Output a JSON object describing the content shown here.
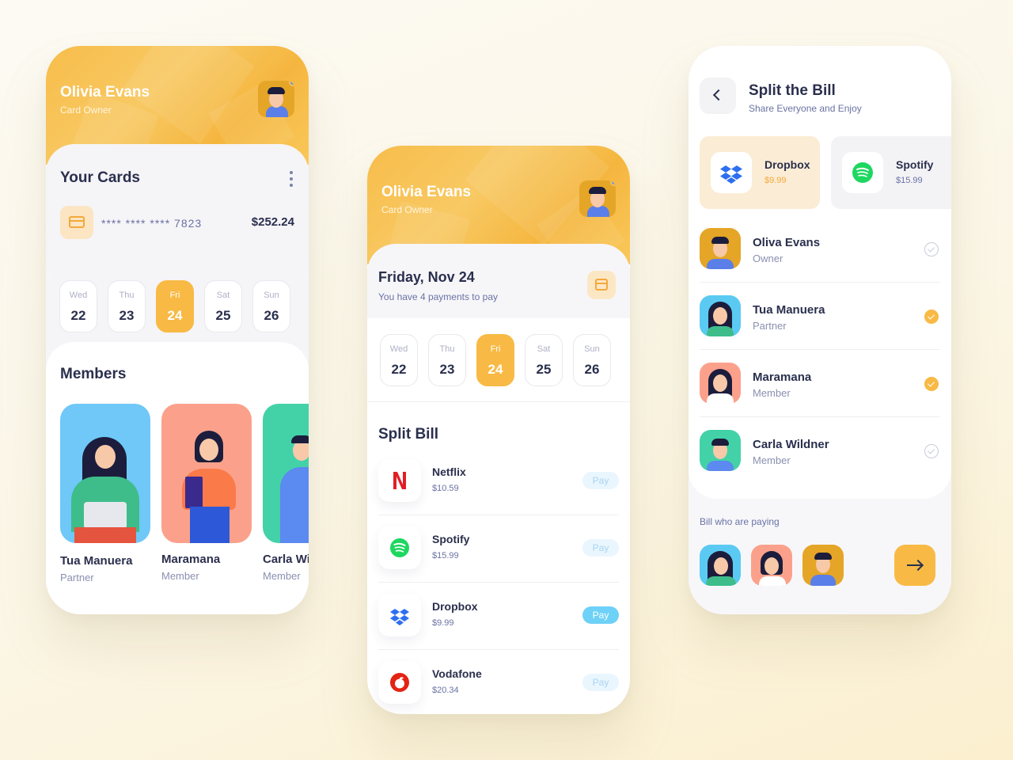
{
  "owner": {
    "name": "Olivia Evans",
    "role": "Card Owner"
  },
  "cards": {
    "title": "Your Cards",
    "number": "**** **** **** 7823",
    "amount": "$252.24"
  },
  "dates": [
    {
      "day": "Wed",
      "num": "22",
      "active": false
    },
    {
      "day": "Thu",
      "num": "23",
      "active": false
    },
    {
      "day": "Fri",
      "num": "24",
      "active": true
    },
    {
      "day": "Sat",
      "num": "25",
      "active": false
    },
    {
      "day": "Sun",
      "num": "26",
      "active": false
    }
  ],
  "members": {
    "title": "Members",
    "items": [
      {
        "name": "Tua Manuera",
        "role": "Partner"
      },
      {
        "name": "Maramana",
        "role": "Member"
      },
      {
        "name": "Carla Wildner",
        "role": "Member"
      }
    ]
  },
  "today": {
    "title": "Friday, Nov 24",
    "subtitle": "You have 4 payments to pay"
  },
  "split_bill": {
    "title": "Split Bill",
    "pay_label": "Pay",
    "items": [
      {
        "name": "Netflix",
        "price": "$10.59",
        "icon": "netflix-icon",
        "active": false
      },
      {
        "name": "Spotify",
        "price": "$15.99",
        "icon": "spotify-icon",
        "active": false
      },
      {
        "name": "Dropbox",
        "price": "$9.99",
        "icon": "dropbox-icon",
        "active": true
      },
      {
        "name": "Vodafone",
        "price": "$20.34",
        "icon": "vodafone-icon",
        "active": false
      }
    ]
  },
  "split_the_bill": {
    "title": "Split the Bill",
    "subtitle": "Share Everyone and Enjoy",
    "services": [
      {
        "name": "Dropbox",
        "price": "$9.99",
        "selected": true
      },
      {
        "name": "Spotify",
        "price": "$15.99",
        "selected": false
      }
    ],
    "people": [
      {
        "name": "Oliva Evans",
        "role": "Owner",
        "checked": false
      },
      {
        "name": "Tua Manuera",
        "role": "Partner",
        "checked": true
      },
      {
        "name": "Maramana",
        "role": "Member",
        "checked": true
      },
      {
        "name": "Carla Wildner",
        "role": "Member",
        "checked": false
      }
    ],
    "paying_label": "Bill who are paying"
  },
  "colors": {
    "accent": "#f8ba45",
    "text_dark": "#2a2f4d",
    "text_muted": "#6a72a3",
    "pay_active": "#6ed1f7",
    "dropbox": "#2e6ff0",
    "spotify": "#1ed760",
    "netflix": "#e01e26",
    "vodafone": "#e42313"
  }
}
